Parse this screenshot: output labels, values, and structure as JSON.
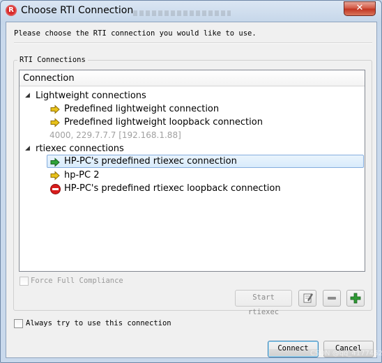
{
  "window": {
    "title": "Choose RTI Connection",
    "close_glyph": "✕",
    "app_icon": "rti-logo-icon"
  },
  "prompt": "Please choose the RTI connection you would like to use.",
  "group_title": "RTI Connections",
  "tree": {
    "column_header": "Connection",
    "groups": [
      {
        "label": "Lightweight connections",
        "expanded": true,
        "items": [
          {
            "label": "Predefined lightweight connection",
            "icon": "yellow-arrow-icon"
          },
          {
            "label": "Predefined lightweight loopback connection",
            "icon": "yellow-arrow-icon"
          },
          {
            "label": "4000, 229.7.7.7 [192.168.1.88]",
            "icon": "none",
            "disabled": true
          }
        ]
      },
      {
        "label": "rtiexec connections",
        "expanded": true,
        "items": [
          {
            "label": "HP-PC's predefined rtiexec connection",
            "icon": "green-arrow-icon",
            "selected": true
          },
          {
            "label": "hp-PC 2",
            "icon": "yellow-arrow-icon"
          },
          {
            "label": "HP-PC's predefined rtiexec loopback connection",
            "icon": "red-stop-icon"
          }
        ]
      }
    ]
  },
  "force_compliance": {
    "label": "Force Full Compliance",
    "checked": false,
    "enabled": false
  },
  "toolbar": {
    "start_rtiexec": "Start rtiexec",
    "edit_icon": "edit-icon",
    "remove_icon": "minus-icon",
    "add_icon": "plus-icon"
  },
  "always_use": {
    "label": "Always try to use this connection",
    "checked": false
  },
  "buttons": {
    "connect": "Connect",
    "cancel": "Cancel"
  },
  "watermark": "CSDN @qq_41774528",
  "colors": {
    "selection_border": "#84acdd",
    "arrow_yellow": "#e8c21a",
    "arrow_green": "#2fa33a",
    "stop_red": "#d91c1c"
  }
}
